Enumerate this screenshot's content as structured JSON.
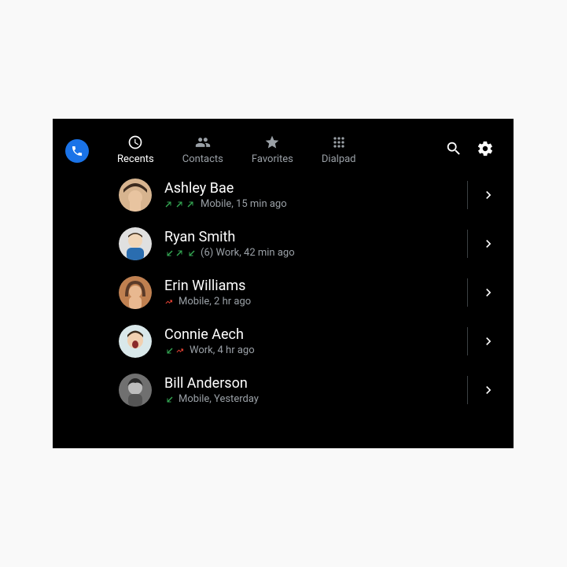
{
  "tabs": [
    {
      "id": "recents",
      "label": "Recents",
      "active": true
    },
    {
      "id": "contacts",
      "label": "Contacts",
      "active": false
    },
    {
      "id": "favorites",
      "label": "Favorites",
      "active": false
    },
    {
      "id": "dialpad",
      "label": "Dialpad",
      "active": false
    }
  ],
  "calls": [
    {
      "name": "Ashley Bae",
      "arrows": [
        "out-ok",
        "out-ok",
        "out-ok"
      ],
      "detail": "Mobile, 15 min ago",
      "count_prefix": ""
    },
    {
      "name": "Ryan Smith",
      "arrows": [
        "in-ok",
        "out-ok",
        "in-ok"
      ],
      "detail": "Work, 42 min ago",
      "count_prefix": "(6) "
    },
    {
      "name": "Erin Williams",
      "arrows": [
        "missed"
      ],
      "detail": "Mobile, 2 hr ago",
      "count_prefix": ""
    },
    {
      "name": "Connie Aech",
      "arrows": [
        "in-ok",
        "missed"
      ],
      "detail": "Work, 4 hr ago",
      "count_prefix": ""
    },
    {
      "name": "Bill Anderson",
      "arrows": [
        "in-ok"
      ],
      "detail": "Mobile, Yesterday",
      "count_prefix": ""
    }
  ],
  "colors": {
    "arrow_ok": "#34a853",
    "arrow_missed": "#ea4335"
  },
  "avatars": [
    {
      "bg": "#d7b48f",
      "hat": "#3b2a1e",
      "skin": "#e8c4a0"
    },
    {
      "bg": "#e0e0e0",
      "hair": "#3a2a1a",
      "skin": "#f1d6b8",
      "shirt": "#2a6db0"
    },
    {
      "bg": "#c08050",
      "hair": "#5a3a28",
      "skin": "#e8b890"
    },
    {
      "bg": "#d9e8ea",
      "hair": "#3a2a1a",
      "skin": "#f1d0b0",
      "mouth": "#8a2a2a"
    },
    {
      "bg": "#707070",
      "hair": "#2a2a2a",
      "skin": "#bdbdbd"
    }
  ]
}
